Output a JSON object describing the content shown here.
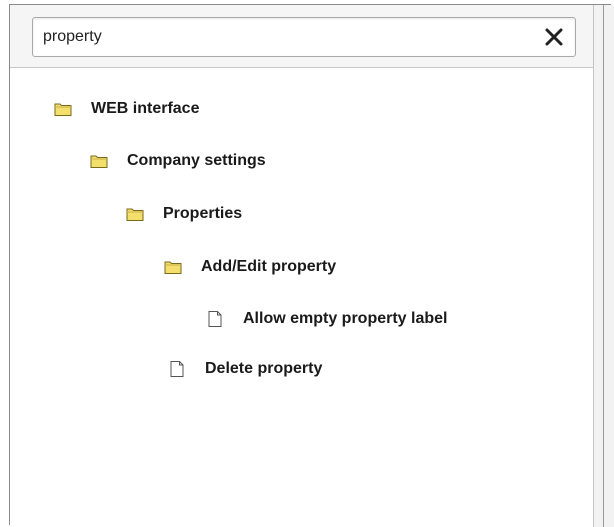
{
  "search": {
    "value": "property",
    "clear_icon": "close-icon"
  },
  "tree": {
    "nodes": [
      {
        "label": "WEB interface",
        "icon": "folder-icon",
        "level": 0
      },
      {
        "label": "Company settings",
        "icon": "folder-icon",
        "level": 1
      },
      {
        "label": "Properties",
        "icon": "folder-icon",
        "level": 2
      },
      {
        "label": "Add/Edit property",
        "icon": "folder-icon",
        "level": 3
      },
      {
        "label": "Allow empty property label",
        "icon": "document-icon",
        "level": 4
      },
      {
        "label": "Delete property",
        "icon": "document-icon",
        "level": 3
      }
    ]
  },
  "colors": {
    "folder_fill": "#f3df6c",
    "folder_stroke": "#7a6a1a",
    "document_fill": "#ffffff",
    "document_stroke": "#555555"
  }
}
